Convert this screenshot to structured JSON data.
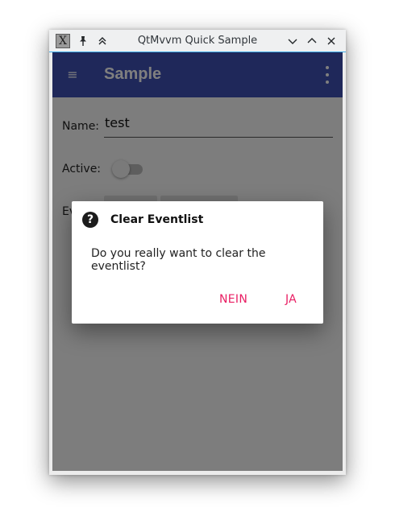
{
  "window": {
    "title": "QtMvvm Quick Sample",
    "app_icon_glyph": "X",
    "controls": {
      "pin_icon": "pin-icon",
      "keep_above_icon": "keep-above-icon",
      "minimize_glyph": "⌵",
      "maximize_glyph": "⌃",
      "close_glyph": "✕"
    }
  },
  "toolbar": {
    "title": "Sample",
    "menu_glyph": "≡",
    "color": "#3f51b5"
  },
  "form": {
    "name_label": "Name:",
    "name_value": "test",
    "active_label": "Active:",
    "active_on": false,
    "events_label": "Ev"
  },
  "dialog": {
    "icon_glyph": "?",
    "title": "Clear Eventlist",
    "message": "Do you really want to clear the eventlist?",
    "no_label": "NEIN",
    "yes_label": "JA",
    "accent": "#e91e63"
  }
}
